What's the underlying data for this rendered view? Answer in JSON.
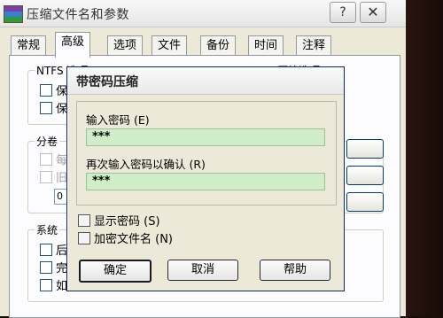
{
  "outer": {
    "title": "压缩文件名和参数",
    "help_label": "?",
    "close_label": "✕",
    "tabs": [
      "常规",
      "高级",
      "选项",
      "文件",
      "备份",
      "时间",
      "注释"
    ],
    "active_tab": "高级",
    "bg_group_ntfs_label": "NTFS 选项",
    "bg_group_ntfs_items": [
      "保",
      "保"
    ],
    "bg_group_split_label": "分卷",
    "bg_group_split_items": [
      "每",
      "旧"
    ],
    "bg_field_value": "0",
    "bg_group_system_label": "系统",
    "bg_group_system_items": [
      "后",
      "完",
      "如"
    ],
    "bg_right_label": "压缩选项"
  },
  "dialog": {
    "title": "带密码压缩",
    "password_label": "输入密码 (E)",
    "password_value": "***",
    "confirm_label": "再次输入密码以确认 (R)",
    "confirm_value": "***",
    "show_password_label": "显示密码 (S)",
    "encrypt_filenames_label": "加密文件名 (N)",
    "ok_label": "确定",
    "cancel_label": "取消",
    "help_label": "帮助"
  },
  "colors": {
    "password_field_bg": "#cfeec8",
    "dialog_bg": "#ece9d8"
  }
}
